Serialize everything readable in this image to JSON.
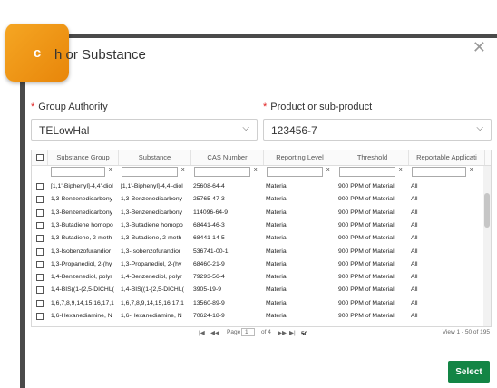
{
  "badge": {
    "letter": "c"
  },
  "dialog": {
    "title": "h or Substance",
    "close_icon": "close-icon"
  },
  "fields": {
    "group_authority": {
      "label": "Group Authority",
      "value": "TELowHal"
    },
    "product": {
      "label": "Product or sub-product",
      "value": "123456-7"
    }
  },
  "grid": {
    "columns": [
      "Substance Group",
      "Substance",
      "CAS Number",
      "Reporting Level",
      "Threshold",
      "Reportable Applicati"
    ],
    "filter_clear": "x",
    "rows": [
      [
        "[1,1'-Biphenyl]-4,4'-diol",
        "[1,1'-Biphenyl]-4,4'-diol",
        "25608-64-4",
        "Material",
        "900 PPM of Material",
        "All"
      ],
      [
        "1,3-Benzenedicarbony",
        "1,3-Benzenedicarbony",
        "25765-47-3",
        "Material",
        "900 PPM of Material",
        "All"
      ],
      [
        "1,3-Benzenedicarbony",
        "1,3-Benzenedicarbony",
        "114096-64-9",
        "Material",
        "900 PPM of Material",
        "All"
      ],
      [
        "1,3-Butadiene homopo",
        "1,3-Butadiene homopo",
        "68441-46-3",
        "Material",
        "900 PPM of Material",
        "All"
      ],
      [
        "1,3-Butadiene, 2-meth",
        "1,3-Butadiene, 2-meth",
        "68441-14-5",
        "Material",
        "900 PPM of Material",
        "All"
      ],
      [
        "1,3-Isobenzofurandior",
        "1,3-Isobenzofurandior",
        "536741-00-1",
        "Material",
        "900 PPM of Material",
        "All"
      ],
      [
        "1,3-Propanediol, 2-(hy",
        "1,3-Propanediol, 2-(hy",
        "68460-21-9",
        "Material",
        "900 PPM of Material",
        "All"
      ],
      [
        "1,4-Benzenediol, polyr",
        "1,4-Benzenediol, polyr",
        "79293-56-4",
        "Material",
        "900 PPM of Material",
        "All"
      ],
      [
        "1,4-BIS((1-(2,5-DICHL(",
        "1,4-BIS((1-(2,5-DICHL(",
        "3905-19-9",
        "Material",
        "900 PPM of Material",
        "All"
      ],
      [
        "1,6,7,8,9,14,15,16,17,1",
        "1,6,7,8,9,14,15,16,17,1",
        "13560-89-9",
        "Material",
        "900 PPM of Material",
        "All"
      ],
      [
        "1,6-Hexanediamine, N",
        "1,6-Hexanediamine, N",
        "70624-18-9",
        "Material",
        "900 PPM of Material",
        "All"
      ]
    ]
  },
  "pager": {
    "first": "|◀",
    "prev": "◀◀",
    "page_label": "Page",
    "page_value": "1",
    "of_label": "of 4",
    "next": "▶▶",
    "last": "▶|",
    "per_page": "50",
    "view_text": "View 1 - 50 of 195"
  },
  "actions": {
    "select_label": "Select"
  },
  "colors": {
    "accent": "#138545",
    "badge": "#f5a623",
    "required": "#e02020"
  }
}
